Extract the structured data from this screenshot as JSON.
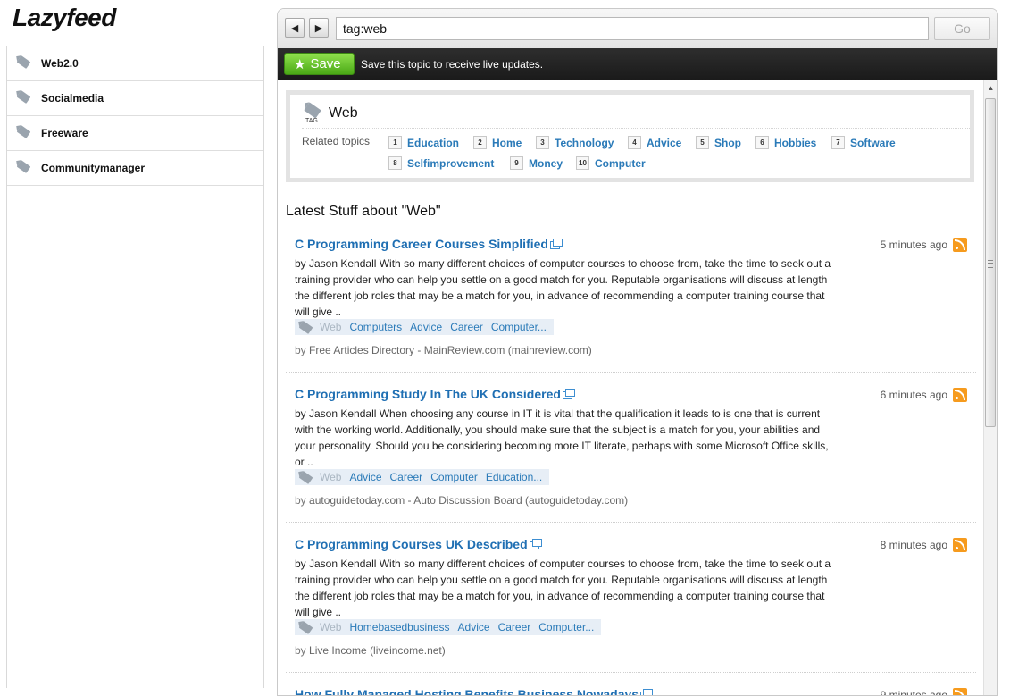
{
  "app": {
    "logo": "Lazyfeed"
  },
  "sidebar": {
    "items": [
      {
        "label": "Web2.0"
      },
      {
        "label": "Socialmedia"
      },
      {
        "label": "Freeware"
      },
      {
        "label": "Communitymanager"
      }
    ]
  },
  "toolbar": {
    "back_icon": "back-arrow-icon",
    "forward_icon": "forward-arrow-icon",
    "address_value": "tag:web",
    "go_label": "Go"
  },
  "savebar": {
    "save_label": "Save",
    "message": "Save this topic to receive live updates."
  },
  "topic": {
    "icon_label": "TAG",
    "title": "Web",
    "related_label": "Related topics",
    "related": [
      {
        "num": "1",
        "label": "Education"
      },
      {
        "num": "2",
        "label": "Home"
      },
      {
        "num": "3",
        "label": "Technology"
      },
      {
        "num": "4",
        "label": "Advice"
      },
      {
        "num": "5",
        "label": "Shop"
      },
      {
        "num": "6",
        "label": "Hobbies"
      },
      {
        "num": "7",
        "label": "Software"
      },
      {
        "num": "8",
        "label": "Selfimprovement"
      },
      {
        "num": "9",
        "label": "Money"
      },
      {
        "num": "10",
        "label": "Computer"
      }
    ]
  },
  "latest": {
    "heading": "Latest Stuff about \"Web\"",
    "articles": [
      {
        "title": "C Programming Career Courses Simplified",
        "time": "5 minutes ago",
        "body": "by Jason Kendall With so many different choices of computer courses to choose from, take the time to seek out a training provider who can help you settle on a good match for you. Reputable organisations will discuss at length the different job roles that may be a match for you, in advance of recommending a computer training course that will give ..",
        "current_tag": "Web",
        "tags": [
          "Computers",
          "Advice",
          "Career",
          "Computer..."
        ],
        "by": "by",
        "source": "Free Articles Directory - MainReview.com (mainreview.com)"
      },
      {
        "title": "C Programming Study In The UK Considered",
        "time": "6 minutes ago",
        "body": "by Jason Kendall When choosing any course in IT it is vital that the qualification it leads to is one that is current with the working world. Additionally, you should make sure that the subject is a match for you, your abilities and your personality. Should you be considering becoming more IT literate, perhaps with some Microsoft Office skills, or ..",
        "current_tag": "Web",
        "tags": [
          "Advice",
          "Career",
          "Computer",
          "Education..."
        ],
        "by": "by",
        "source": "autoguidetoday.com - Auto Discussion Board (autoguidetoday.com)"
      },
      {
        "title": "C Programming Courses UK Described",
        "time": "8 minutes ago",
        "body": "by Jason Kendall With so many different choices of computer courses to choose from, take the time to seek out a training provider who can help you settle on a good match for you. Reputable organisations will discuss at length the different job roles that may be a match for you, in advance of recommending a computer training course that will give ..",
        "current_tag": "Web",
        "tags": [
          "Homebasedbusiness",
          "Advice",
          "Career",
          "Computer..."
        ],
        "by": "by",
        "source": "Live Income (liveincome.net)"
      },
      {
        "title": "How Fully Managed Hosting Benefits Business Nowadays",
        "time": "9 minutes ago",
        "body": "",
        "current_tag": "",
        "tags": [],
        "by": "",
        "source": ""
      }
    ]
  },
  "colors": {
    "link": "#1f6fb3",
    "save_green": "#4aa916",
    "savebar_bg": "#1a1a1a",
    "rss_orange": "#f69b1e"
  }
}
